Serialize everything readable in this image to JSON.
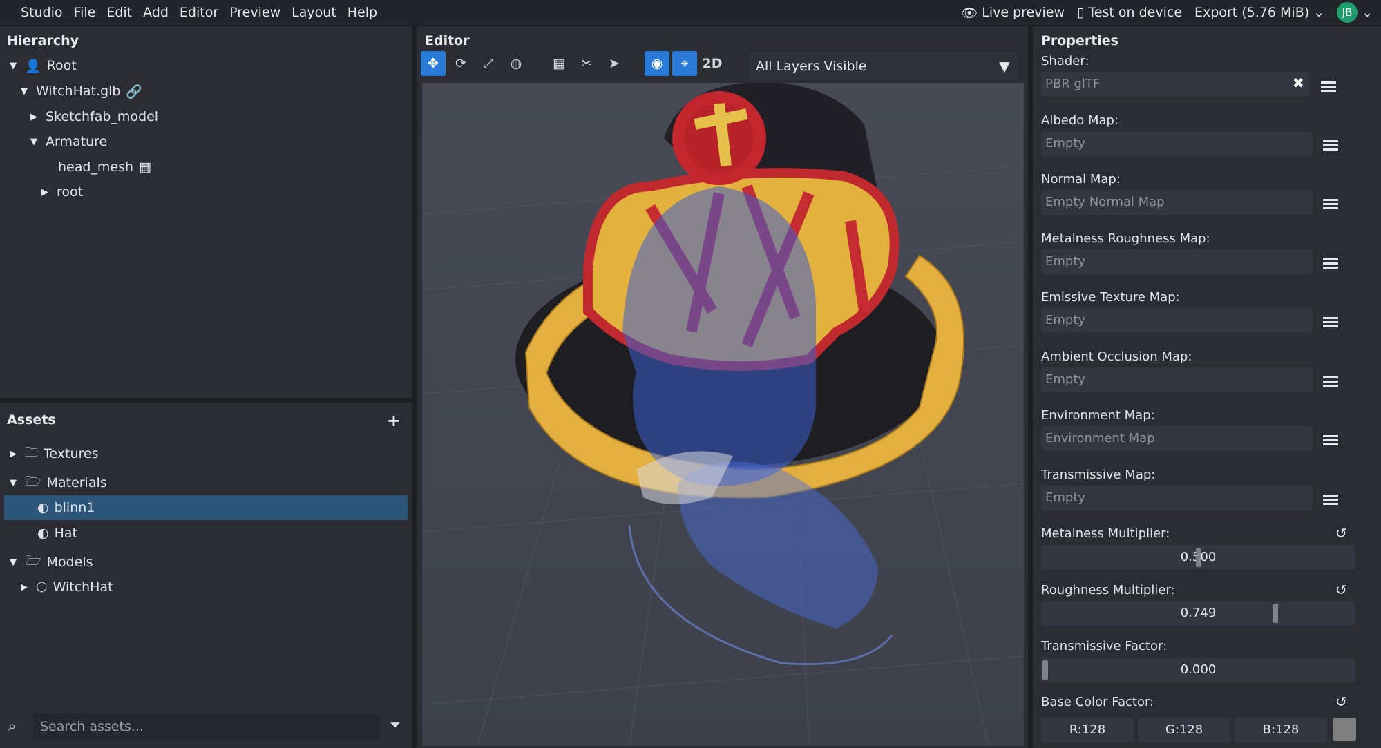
{
  "menubar": {
    "items": [
      "Studio",
      "File",
      "Edit",
      "Add",
      "Editor",
      "Preview",
      "Layout",
      "Help"
    ],
    "live_preview": "Live preview",
    "test_on_device": "Test on device",
    "export": "Export (5.76 MiB)",
    "avatar": "JB"
  },
  "hierarchy": {
    "title": "Hierarchy",
    "nodes": [
      "Root",
      "WitchHat.glb",
      "Sketchfab_model",
      "Armature",
      "head_mesh",
      "root"
    ]
  },
  "assets": {
    "title": "Assets",
    "rows": [
      "Textures",
      "Materials",
      "blinn1",
      "Hat",
      "Models",
      "WitchHat"
    ],
    "search_placeholder": "Search assets..."
  },
  "editor": {
    "title": "Editor",
    "mode_2d": "2D",
    "layers": "All Layers Visible"
  },
  "properties": {
    "title": "Properties",
    "shader_label": "Shader:",
    "shader_value": "PBR glTF",
    "maps": [
      {
        "label": "Albedo Map:",
        "value": "Empty"
      },
      {
        "label": "Normal Map:",
        "value": "Empty Normal Map"
      },
      {
        "label": "Metalness Roughness Map:",
        "value": "Empty"
      },
      {
        "label": "Emissive Texture Map:",
        "value": "Empty"
      },
      {
        "label": "Ambient Occlusion Map:",
        "value": "Empty"
      },
      {
        "label": "Environment Map:",
        "value": "Environment Map"
      },
      {
        "label": "Transmissive Map:",
        "value": "Empty"
      }
    ],
    "metalness_label": "Metalness Multiplier:",
    "metalness_value": "0.500",
    "roughness_label": "Roughness Multiplier:",
    "roughness_value": "0.749",
    "transmissive_label": "Transmissive Factor:",
    "transmissive_value": "0.000",
    "base_color_label": "Base Color Factor:",
    "r": "R:128",
    "g": "G:128",
    "b": "B:128",
    "swatch_color": "#808080"
  }
}
